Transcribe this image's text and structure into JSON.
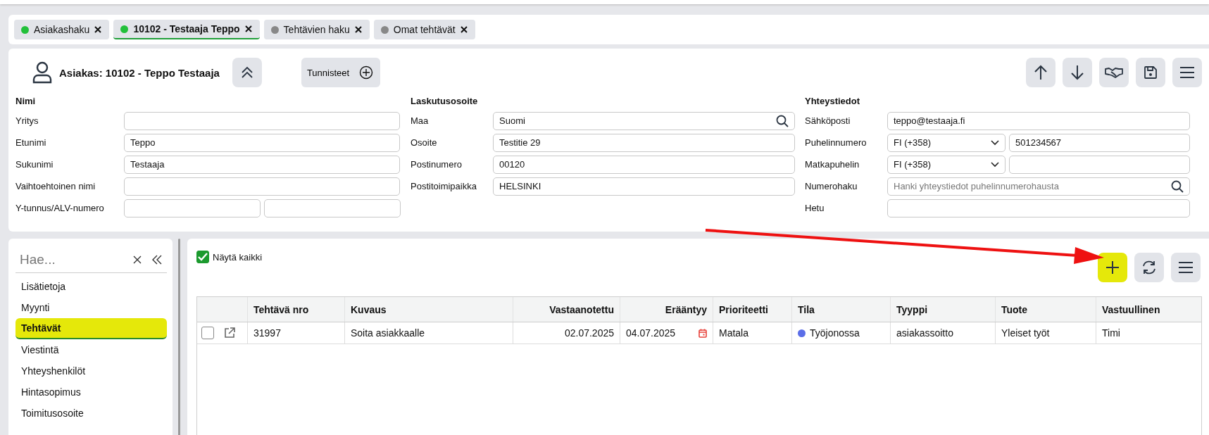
{
  "tabs": [
    {
      "label": "Asiakashaku",
      "selected": false,
      "color": "#22c03a"
    },
    {
      "label": "10102 - Testaaja Teppo",
      "selected": true,
      "color": "#22c03a"
    },
    {
      "label": "Tehtävien haku",
      "selected": false,
      "color": "#888888"
    },
    {
      "label": "Omat tehtävät",
      "selected": false,
      "color": "#888888"
    }
  ],
  "customer": {
    "title": "Asiakas: 10102 - Teppo Testaaja",
    "tags_button": "Tunnisteet"
  },
  "header_toolbar": [
    {
      "kind": "up"
    },
    {
      "kind": "down"
    },
    {
      "kind": "handshake"
    },
    {
      "kind": "save"
    },
    {
      "kind": "menu"
    }
  ],
  "sections": [
    {
      "heading": "Nimi",
      "fields": [
        {
          "label": "Yritys",
          "kind": "text"
        },
        {
          "label": "Etunimi",
          "kind": "text",
          "value": "Teppo"
        },
        {
          "label": "Sukunimi",
          "kind": "text",
          "value": "Testaaja"
        },
        {
          "label": "Vaihtoehtoinen nimi",
          "kind": "text"
        },
        {
          "label": "Y-tunnus/ALV-numero",
          "kind": "split"
        }
      ]
    },
    {
      "heading": "Laskutusosoite",
      "fields": [
        {
          "label": "Maa",
          "kind": "search",
          "value": "Suomi"
        },
        {
          "label": "Osoite",
          "kind": "text",
          "value": "Testitie 29"
        },
        {
          "label": "Postinumero",
          "kind": "text",
          "value": "00120"
        },
        {
          "label": "Postitoimipaikka",
          "kind": "text",
          "value": "HELSINKI"
        }
      ]
    },
    {
      "heading": "Yhteystiedot",
      "fields": [
        {
          "label": "Sähköposti",
          "kind": "text",
          "value": "teppo@testaaja.fi"
        },
        {
          "label": "Puhelinnumero",
          "kind": "phone",
          "country": "FI (+358)",
          "value": "501234567"
        },
        {
          "label": "Matkapuhelin",
          "kind": "phone",
          "country": "FI (+358)"
        },
        {
          "label": "Numerohaku",
          "kind": "search",
          "placeholder": "Hanki yhteystiedot puhelinnumerohausta"
        },
        {
          "label": "Hetu",
          "kind": "text"
        }
      ]
    }
  ],
  "sidebar": {
    "search_placeholder": "Hae...",
    "items": [
      {
        "label": "Lisätietoja",
        "selected": false
      },
      {
        "label": "Myynti",
        "selected": false
      },
      {
        "label": "Tehtävät",
        "selected": true
      },
      {
        "label": "Viestintä",
        "selected": false
      },
      {
        "label": "Yhteyshenkilöt",
        "selected": false
      },
      {
        "label": "Hintasopimus",
        "selected": false
      },
      {
        "label": "Toimitusosoite",
        "selected": false
      }
    ]
  },
  "tasks": {
    "show_all": {
      "label": "Näytä kaikki",
      "checked": true
    },
    "toolbar": [
      {
        "kind": "add",
        "highlighted": true
      },
      {
        "kind": "refresh",
        "highlighted": false
      },
      {
        "kind": "menu",
        "highlighted": false
      }
    ],
    "columns": [
      {
        "label": "Tehtävä nro",
        "kind": "text"
      },
      {
        "label": "Kuvaus",
        "kind": "text"
      },
      {
        "label": "Vastaanotettu",
        "kind": "date"
      },
      {
        "label": "Erääntyy",
        "kind": "date"
      },
      {
        "label": "Prioriteetti",
        "kind": "text"
      },
      {
        "label": "Tila",
        "kind": "text"
      },
      {
        "label": "Tyyppi",
        "kind": "text"
      },
      {
        "label": "Tuote",
        "kind": "text"
      },
      {
        "label": "Vastuullinen",
        "kind": "text"
      }
    ],
    "rows": [
      {
        "checked": false,
        "number": "31997",
        "description": "Soita asiakkaalle",
        "received": "02.07.2025",
        "due": "04.07.2025",
        "priority": "Matala",
        "status": {
          "label": "Työjonossa",
          "color": "#5b6ee8"
        },
        "type": "asiakassoitto",
        "product": "Yleiset työt",
        "owner": "Timi"
      }
    ]
  }
}
